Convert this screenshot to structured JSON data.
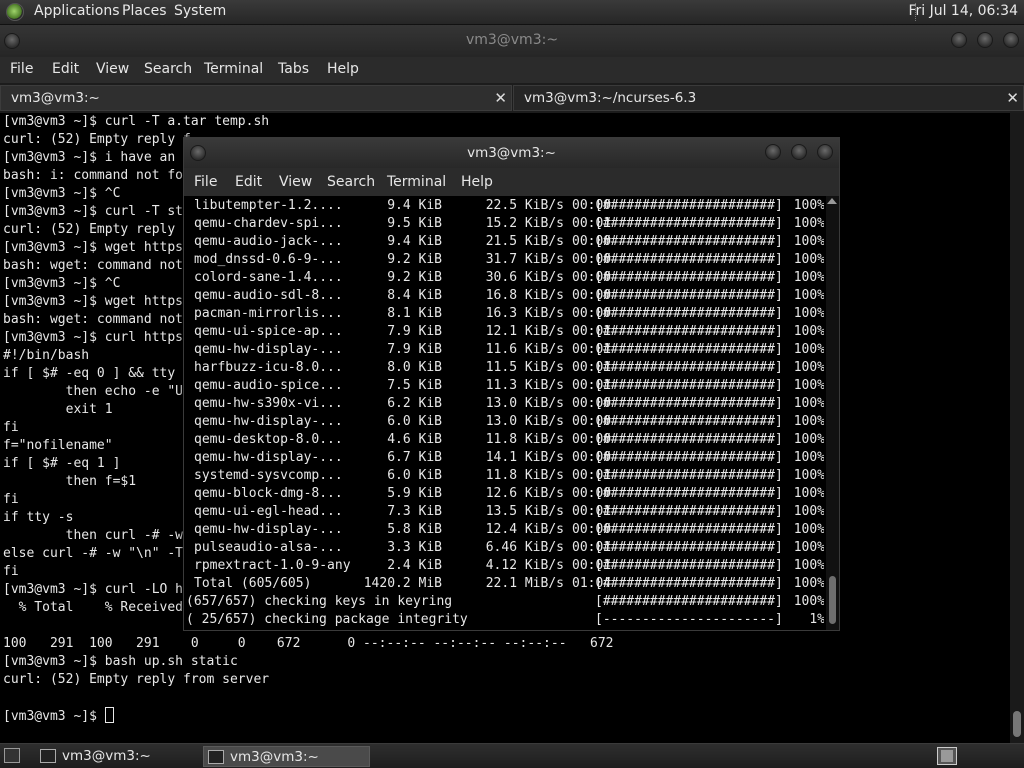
{
  "top_panel": {
    "menus": [
      "Applications",
      "Places",
      "System"
    ],
    "clock": "Fri Jul 14, 06:34"
  },
  "main_window": {
    "title": "vm3@vm3:~",
    "menu": [
      "File",
      "Edit",
      "View",
      "Search",
      "Terminal",
      "Tabs",
      "Help"
    ],
    "tabs": [
      {
        "label": "vm3@vm3:~",
        "close": "✕"
      },
      {
        "label": "vm3@vm3:~/ncurses-6.3",
        "close": "✕"
      }
    ],
    "terminal_lines": [
      "[vm3@vm3 ~]$ curl -T a.tar temp.sh",
      "curl: (52) Empty reply f",
      "[vm3@vm3 ~]$ i have an",
      "bash: i: command not fo",
      "[vm3@vm3 ~]$ ^C",
      "[vm3@vm3 ~]$ curl -T st",
      "curl: (52) Empty reply",
      "[vm3@vm3 ~]$ wget https",
      "bash: wget: command not",
      "[vm3@vm3 ~]$ ^C",
      "[vm3@vm3 ~]$ wget https",
      "bash: wget: command not",
      "[vm3@vm3 ~]$ curl https",
      "#!/bin/bash",
      "if [ $# -eq 0 ] && tty",
      "        then echo -e \"U",
      "        exit 1",
      "fi",
      "f=\"nofilename\"",
      "if [ $# -eq 1 ]",
      "        then f=$1",
      "fi",
      "if tty -s",
      "        then curl -# -w",
      "else curl -# -w \"\\n\" -T",
      "fi",
      "[vm3@vm3 ~]$ curl -LO h",
      "  % Total    % Received",
      "",
      "100   291  100   291    0     0    672      0 --:--:-- --:--:-- --:--:--   672",
      "[vm3@vm3 ~]$ bash up.sh static",
      "curl: (52) Empty reply from server",
      "",
      "[vm3@vm3 ~]$ "
    ]
  },
  "float_window": {
    "title": "vm3@vm3:~",
    "menu": [
      "File",
      "Edit",
      "View",
      "Search",
      "Terminal",
      "Help"
    ],
    "rows": [
      {
        "name": "libutempter-1.2....",
        "size": "9.4 KiB",
        "speed": "22.5 KiB/s",
        "time": "00:00",
        "bar": "[######################]",
        "pct": "100%"
      },
      {
        "name": "qemu-chardev-spi...",
        "size": "9.5 KiB",
        "speed": "15.2 KiB/s",
        "time": "00:01",
        "bar": "[######################]",
        "pct": "100%"
      },
      {
        "name": "qemu-audio-jack-...",
        "size": "9.4 KiB",
        "speed": "21.5 KiB/s",
        "time": "00:00",
        "bar": "[######################]",
        "pct": "100%"
      },
      {
        "name": "mod_dnssd-0.6-9-...",
        "size": "9.2 KiB",
        "speed": "31.7 KiB/s",
        "time": "00:00",
        "bar": "[######################]",
        "pct": "100%"
      },
      {
        "name": "colord-sane-1.4....",
        "size": "9.2 KiB",
        "speed": "30.6 KiB/s",
        "time": "00:00",
        "bar": "[######################]",
        "pct": "100%"
      },
      {
        "name": "qemu-audio-sdl-8...",
        "size": "8.4 KiB",
        "speed": "16.8 KiB/s",
        "time": "00:00",
        "bar": "[######################]",
        "pct": "100%"
      },
      {
        "name": "pacman-mirrorlis...",
        "size": "8.1 KiB",
        "speed": "16.3 KiB/s",
        "time": "00:00",
        "bar": "[######################]",
        "pct": "100%"
      },
      {
        "name": "qemu-ui-spice-ap...",
        "size": "7.9 KiB",
        "speed": "12.1 KiB/s",
        "time": "00:01",
        "bar": "[######################]",
        "pct": "100%"
      },
      {
        "name": "qemu-hw-display-...",
        "size": "7.9 KiB",
        "speed": "11.6 KiB/s",
        "time": "00:01",
        "bar": "[######################]",
        "pct": "100%"
      },
      {
        "name": "harfbuzz-icu-8.0...",
        "size": "8.0 KiB",
        "speed": "11.5 KiB/s",
        "time": "00:01",
        "bar": "[######################]",
        "pct": "100%"
      },
      {
        "name": "qemu-audio-spice...",
        "size": "7.5 KiB",
        "speed": "11.3 KiB/s",
        "time": "00:01",
        "bar": "[######################]",
        "pct": "100%"
      },
      {
        "name": "qemu-hw-s390x-vi...",
        "size": "6.2 KiB",
        "speed": "13.0 KiB/s",
        "time": "00:00",
        "bar": "[######################]",
        "pct": "100%"
      },
      {
        "name": "qemu-hw-display-...",
        "size": "6.0 KiB",
        "speed": "13.0 KiB/s",
        "time": "00:00",
        "bar": "[######################]",
        "pct": "100%"
      },
      {
        "name": "qemu-desktop-8.0...",
        "size": "4.6 KiB",
        "speed": "11.8 KiB/s",
        "time": "00:00",
        "bar": "[######################]",
        "pct": "100%"
      },
      {
        "name": "qemu-hw-display-...",
        "size": "6.7 KiB",
        "speed": "14.1 KiB/s",
        "time": "00:00",
        "bar": "[######################]",
        "pct": "100%"
      },
      {
        "name": "systemd-sysvcomp...",
        "size": "6.0 KiB",
        "speed": "11.8 KiB/s",
        "time": "00:01",
        "bar": "[######################]",
        "pct": "100%"
      },
      {
        "name": "qemu-block-dmg-8...",
        "size": "5.9 KiB",
        "speed": "12.6 KiB/s",
        "time": "00:00",
        "bar": "[######################]",
        "pct": "100%"
      },
      {
        "name": "qemu-ui-egl-head...",
        "size": "7.3 KiB",
        "speed": "13.5 KiB/s",
        "time": "00:01",
        "bar": "[######################]",
        "pct": "100%"
      },
      {
        "name": "qemu-hw-display-...",
        "size": "5.8 KiB",
        "speed": "12.4 KiB/s",
        "time": "00:00",
        "bar": "[######################]",
        "pct": "100%"
      },
      {
        "name": "pulseaudio-alsa-...",
        "size": "3.3 KiB",
        "speed": "6.46 KiB/s",
        "time": "00:01",
        "bar": "[######################]",
        "pct": "100%"
      },
      {
        "name": "rpmextract-1.0-9-any",
        "size": "2.4 KiB",
        "speed": "4.12 KiB/s",
        "time": "00:01",
        "bar": "[######################]",
        "pct": "100%"
      },
      {
        "name": "Total (605/605)",
        "size": "1420.2 MiB",
        "speed": "22.1 MiB/s",
        "time": "01:04",
        "bar": "[######################]",
        "pct": "100%"
      }
    ],
    "status_lines": [
      {
        "text": "(657/657) checking keys in keyring",
        "bar": "[######################]",
        "pct": "100%"
      },
      {
        "text": "( 25/657) checking package integrity",
        "bar": "[----------------------]",
        "pct": "1%"
      }
    ]
  },
  "taskbar": {
    "tasks": [
      {
        "label": "vm3@vm3:~",
        "icon": "terminal-icon"
      },
      {
        "label": "vm3@vm3:~",
        "icon": "terminal-icon"
      }
    ]
  }
}
